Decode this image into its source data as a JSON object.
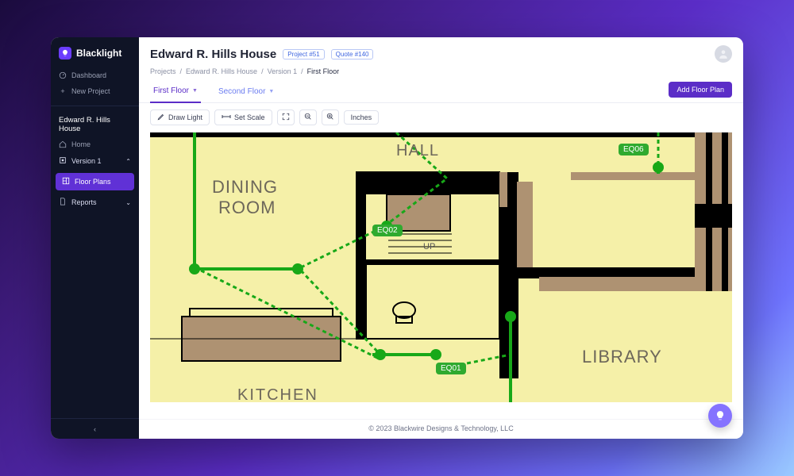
{
  "brand": "Blacklight",
  "sidebar": {
    "dashboard": "Dashboard",
    "new_project": "New Project",
    "project": "Edward R. Hills House",
    "home": "Home",
    "version": "Version 1",
    "floor_plans": "Floor Plans",
    "reports": "Reports"
  },
  "header": {
    "title": "Edward R. Hills House",
    "chip_project": "Project #51",
    "chip_quote": "Quote #140"
  },
  "breadcrumbs": {
    "a": "Projects",
    "b": "Edward R. Hills House",
    "c": "Version 1",
    "d": "First Floor"
  },
  "tabs": {
    "first": "First Floor",
    "second": "Second Floor",
    "add": "Add Floor Plan"
  },
  "toolbar": {
    "draw": "Draw Light",
    "scale": "Set Scale",
    "units": "Inches"
  },
  "plan": {
    "rooms": {
      "hall": "HALL",
      "dining1": "DINING",
      "dining2": "ROOM",
      "library": "LIBRARY",
      "kitchen": "KITCHEN",
      "up": "UP"
    },
    "eq": {
      "eq01": "EQ01",
      "eq02": "EQ02",
      "eq06": "EQ06"
    }
  },
  "footer": "© 2023 Blackwire Designs & Technology, LLC"
}
